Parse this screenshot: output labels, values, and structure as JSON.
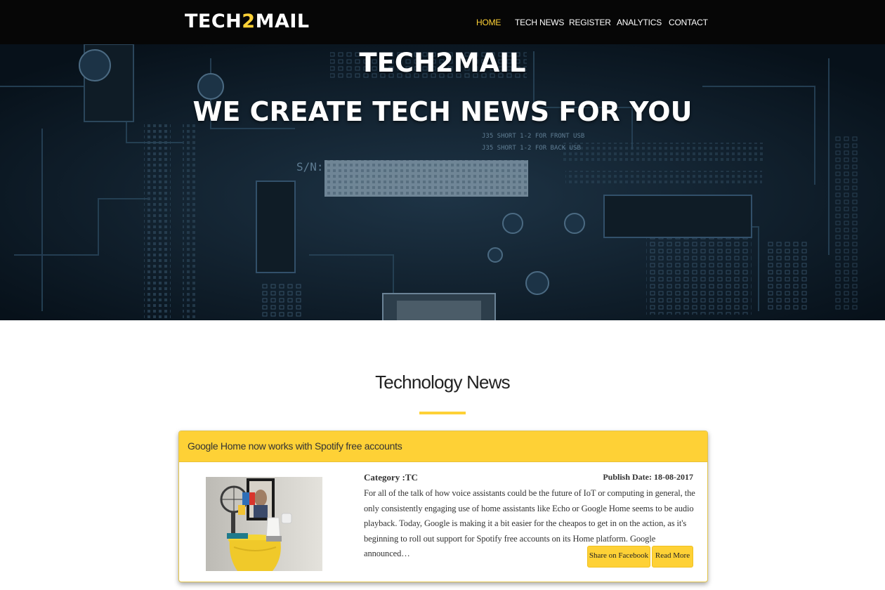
{
  "navbar": {
    "brand_prefix": "TECH",
    "brand_accent": "2",
    "brand_suffix": "MAIL",
    "items": [
      {
        "label": "HOME",
        "active": true
      },
      {
        "label": "TECH NEWS"
      },
      {
        "label": "REGISTER"
      },
      {
        "label": "ANALYTICS"
      },
      {
        "label": "CONTACT"
      }
    ]
  },
  "hero": {
    "title": "TECH2MAIL",
    "subtitle": "WE CREATE TECH NEWS FOR YOU"
  },
  "section": {
    "heading": "Technology News"
  },
  "articles": [
    {
      "title": "Google Home now works with Spotify free accounts",
      "category": "Category :TC",
      "publish_date": "Publish Date: 18-08-2017",
      "summary": " For all of the talk of how voice assistants could be the future of IoT or computing in general, the only consistently engaging use of home assistants like Echo or Google Home seems to be audio playback. Today, Google is making it a bit easier for the cheapos to get in on the action, as it's beginning to roll out support for Spotify free accounts on its Home platform. Google announced…",
      "share_label": "Share on Facebook",
      "read_more_label": "Read More"
    }
  ],
  "colors": {
    "accent": "#fed136",
    "navbar_bg": "#060606",
    "hero_bg": "#0b1620",
    "text": "#333333"
  },
  "icons": {
    "article_image": "google-home-photo"
  }
}
